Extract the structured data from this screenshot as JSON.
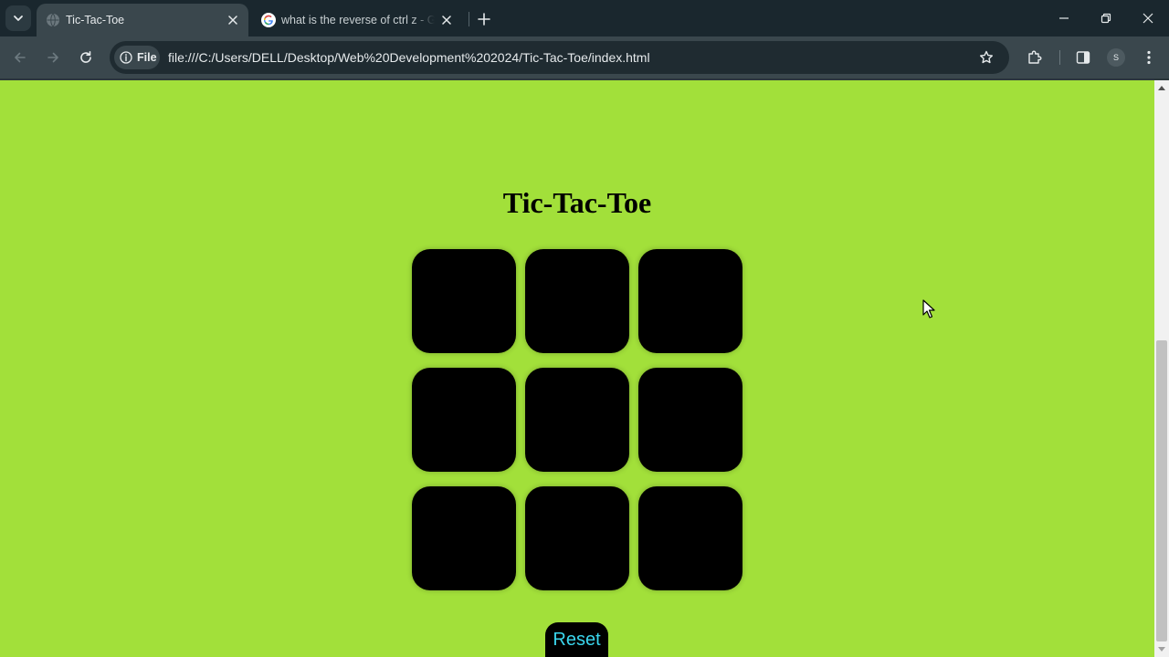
{
  "browser": {
    "tabs": [
      {
        "title": "Tic-Tac-Toe",
        "active": true,
        "favicon": "globe-icon"
      },
      {
        "title": "what is the reverse of ctrl z - Google Search",
        "active": false,
        "favicon": "google-g-icon"
      }
    ],
    "address_bar": {
      "chip_label": "File",
      "url": "file:///C:/Users/DELL/Desktop/Web%20Development%202024/Tic-Tac-Toe/index.html"
    },
    "profile_initial": "S"
  },
  "page": {
    "title": "Tic-Tac-Toe",
    "background_color": "#a2e03a",
    "board": {
      "cells": [
        "",
        "",
        "",
        "",
        "",
        "",
        "",
        "",
        ""
      ]
    },
    "reset_label": "Reset",
    "reset_text_color": "#3ad6ee"
  }
}
